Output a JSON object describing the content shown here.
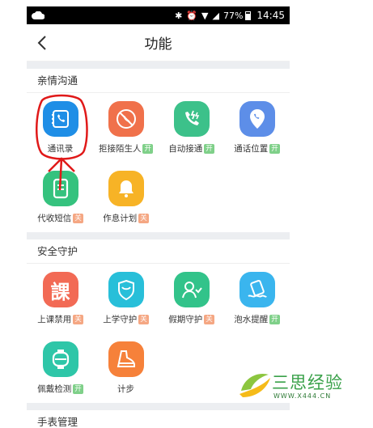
{
  "status_bar": {
    "battery": "77%",
    "time": "14:45"
  },
  "header": {
    "title": "功能"
  },
  "sections": [
    {
      "title": "亲情沟通",
      "items": [
        {
          "label": "通讯录",
          "badge": "",
          "color": "#1f8ee6"
        },
        {
          "label": "拒接陌生人",
          "badge": "开",
          "color": "#f0714b"
        },
        {
          "label": "自动接通",
          "badge": "开",
          "color": "#3cc18a"
        },
        {
          "label": "通话位置",
          "badge": "开",
          "color": "#5d8ee8"
        },
        {
          "label": "代收短信",
          "badge": "关",
          "color": "#35c27e"
        },
        {
          "label": "作息计划",
          "badge": "关",
          "color": "#f7b326"
        }
      ]
    },
    {
      "title": "安全守护",
      "items": [
        {
          "label": "上课禁用",
          "badge": "关",
          "color": "#f26a55",
          "glyph": "課"
        },
        {
          "label": "上学守护",
          "badge": "关",
          "color": "#28bfd9"
        },
        {
          "label": "假期守护",
          "badge": "关",
          "color": "#32c38a"
        },
        {
          "label": "泡水提醒",
          "badge": "开",
          "color": "#3ab5ee"
        },
        {
          "label": "佩戴检测",
          "badge": "开",
          "color": "#2ec6a8"
        },
        {
          "label": "计步",
          "badge": "",
          "color": "#f6813a"
        }
      ]
    }
  ],
  "next_section_title": "手表管理",
  "watermark": {
    "text": "三思经验",
    "url": "WWW.X444.CN"
  }
}
